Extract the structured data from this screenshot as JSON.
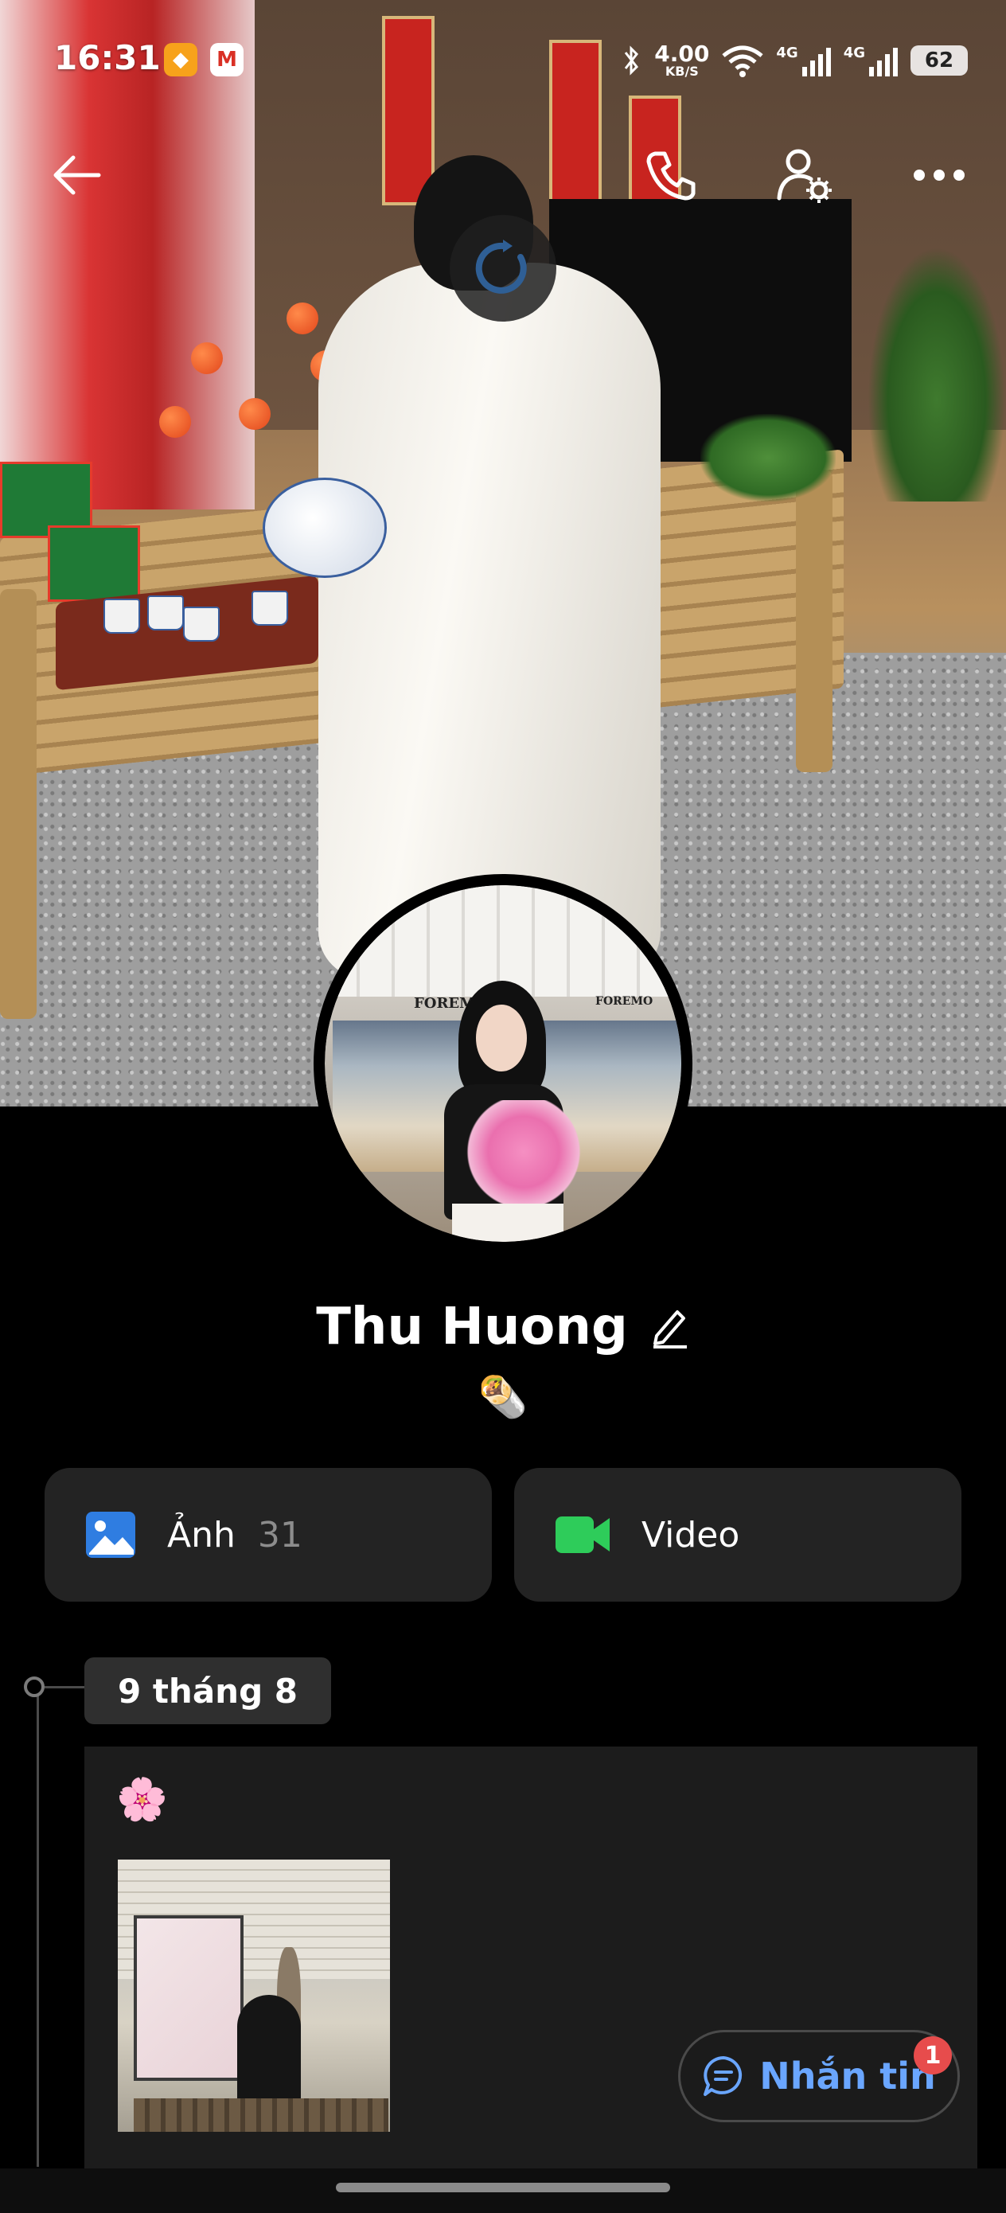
{
  "status_bar": {
    "time": "16:31",
    "network_speed": "4.00",
    "network_speed_unit": "KB/S",
    "sim1_label": "4G",
    "sim2_label": "4G",
    "battery_level": "62",
    "app_icons": [
      "orange-app-icon",
      "gmail-icon"
    ]
  },
  "top_nav": {
    "back_icon": "arrow-left-icon",
    "call_icon": "phone-icon",
    "profile_settings_icon": "user-settings-icon",
    "more_icon": "more-horizontal-icon"
  },
  "cover": {
    "loading_icon": "loading-spinner-icon",
    "avatar_brand_left": "FOREM",
    "avatar_brand_right": "FOREMO"
  },
  "profile": {
    "name": "Thu Huong",
    "edit_icon": "pencil-icon",
    "status_emoji": "🌯"
  },
  "media": {
    "photos": {
      "label": "Ảnh",
      "count": "31",
      "icon": "image-icon"
    },
    "video": {
      "label": "Video",
      "icon": "video-camera-icon"
    }
  },
  "timeline": {
    "date": "9 tháng 8",
    "post_emoji": "🌸"
  },
  "message_button": {
    "label": "Nhắn tin",
    "badge": "1",
    "icon": "chat-bubble-icon"
  },
  "colors": {
    "background": "#000000",
    "card": "#232323",
    "accent_blue": "#6aa6ff",
    "badge_red": "#e74c4c",
    "video_green": "#2ecc5a",
    "photo_blue": "#2f7de1"
  }
}
